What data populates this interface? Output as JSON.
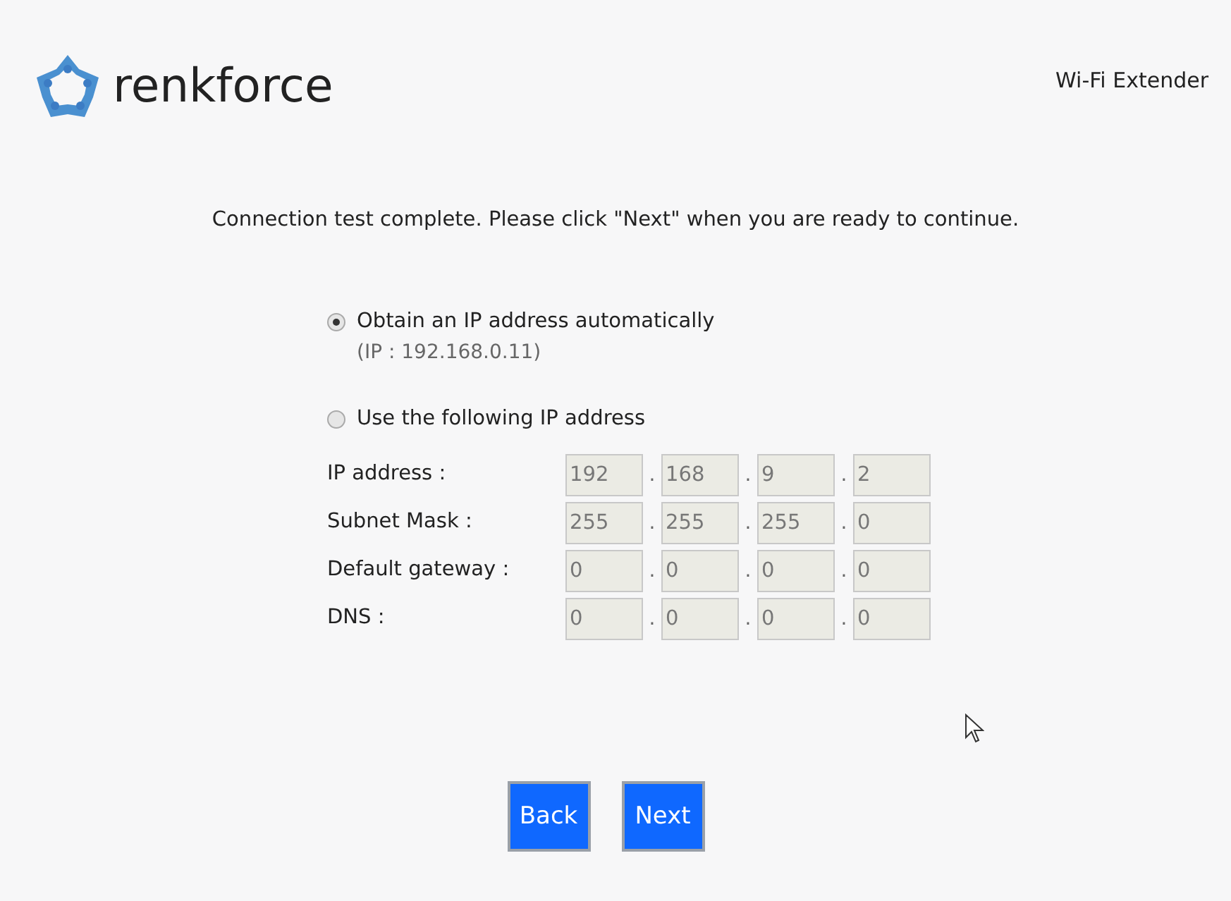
{
  "header": {
    "brand": "renkforce",
    "product": "Wi-Fi Extender"
  },
  "message": "Connection test complete. Please click \"Next\" when you are ready to continue.",
  "options": [
    {
      "label": "Obtain an IP address automatically",
      "note": "(IP : 192.168.0.11)",
      "selected": true
    },
    {
      "label": "Use the following IP address",
      "selected": false
    }
  ],
  "fields": [
    {
      "label": "IP address :",
      "disabled": true,
      "values": [
        "192",
        "168",
        "9",
        "2"
      ]
    },
    {
      "label": "Subnet Mask :",
      "disabled": true,
      "values": [
        "255",
        "255",
        "255",
        "0"
      ]
    },
    {
      "label": "Default gateway :",
      "disabled": true,
      "values": [
        "0",
        "0",
        "0",
        "0"
      ]
    },
    {
      "label": "DNS :",
      "disabled": true,
      "values": [
        "0",
        "0",
        "0",
        "0"
      ]
    }
  ],
  "separator": ".",
  "buttons": [
    "Back",
    "Next"
  ]
}
